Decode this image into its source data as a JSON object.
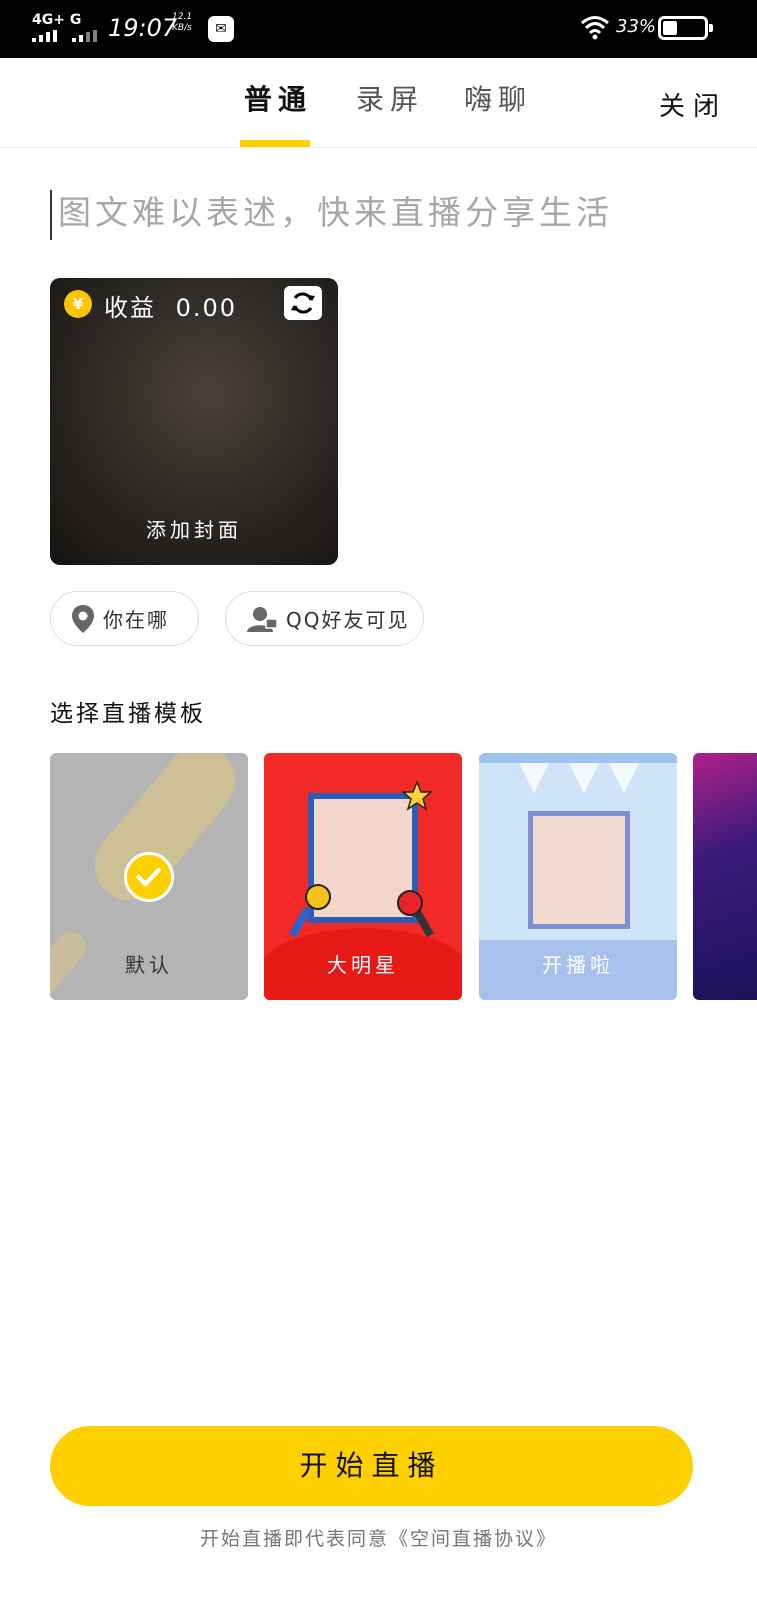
{
  "status_bar": {
    "network": "4G+ G",
    "time": "19:07",
    "speed_value": "12.1",
    "speed_unit": "KB/s",
    "battery_percent": "33%"
  },
  "header": {
    "tabs": [
      {
        "label": "普通",
        "active": true
      },
      {
        "label": "录屏",
        "active": false
      },
      {
        "label": "嗨聊",
        "active": false
      }
    ],
    "close_label": "关闭"
  },
  "title_input": {
    "placeholder": "图文难以表述，快来直播分享生活"
  },
  "cover": {
    "income_label": "收益",
    "income_value": "0.00",
    "currency_symbol": "¥",
    "add_cover_label": "添加封面"
  },
  "pills": {
    "location_label": "你在哪",
    "visibility_label": "QQ好友可见"
  },
  "templates": {
    "section_title": "选择直播模板",
    "items": [
      {
        "label": "默认",
        "selected": true
      },
      {
        "label": "大明星",
        "selected": false
      },
      {
        "label": "开播啦",
        "selected": false
      },
      {
        "label": "",
        "selected": false
      }
    ]
  },
  "footer": {
    "start_label": "开始直播",
    "agreement_text": "开始直播即代表同意《空间直播协议》"
  },
  "colors": {
    "accent": "#ffd000",
    "star_template": "#f22a27",
    "crowd_template": "#cfe4f9"
  }
}
